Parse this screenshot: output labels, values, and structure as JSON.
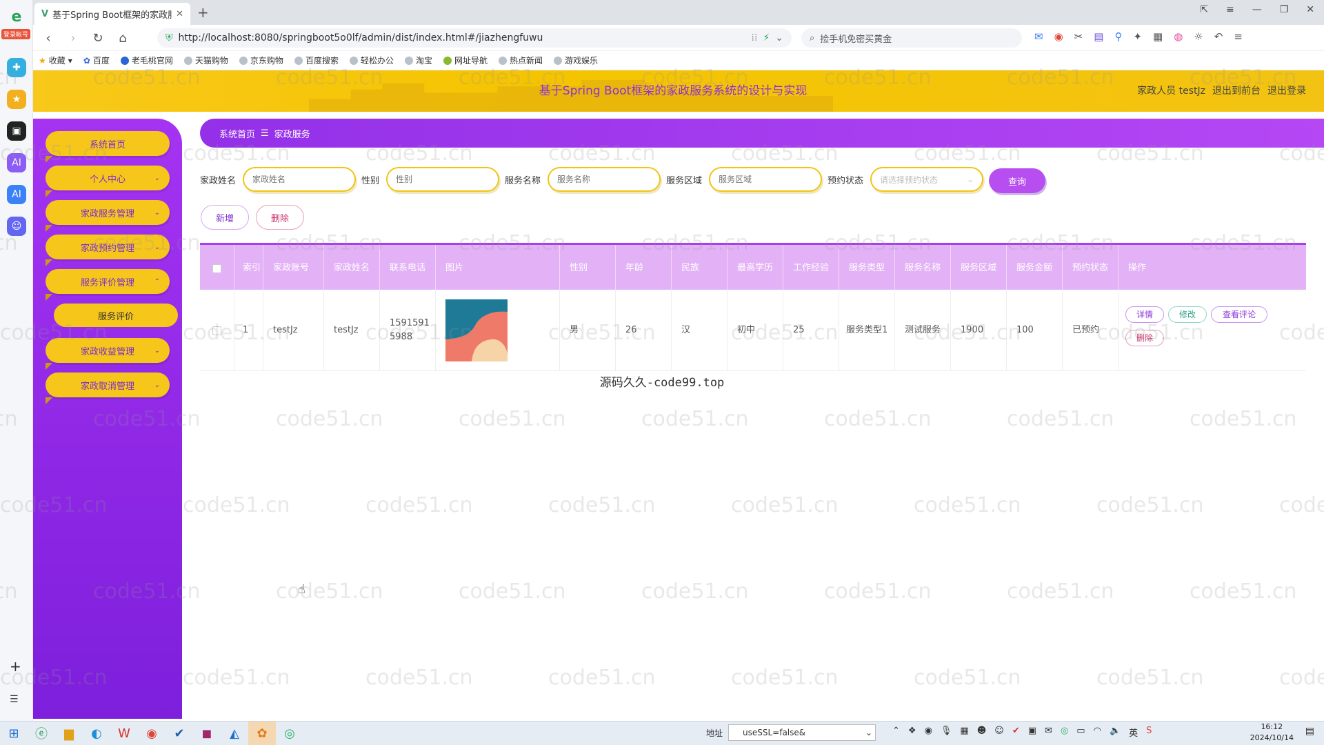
{
  "browser": {
    "tab_title": "基于Spring Boot框架的家政服",
    "url": "http://localhost:8080/springboot5o0lf/admin/dist/index.html#/jiazhengfuwu",
    "search_placeholder": "捡手机免密买黄金",
    "login_badge": "登录帐号",
    "bookmarks": [
      "收藏",
      "百度",
      "老毛桃官网",
      "天猫购物",
      "京东购物",
      "百度搜索",
      "轻松办公",
      "淘宝",
      "网址导航",
      "热点新闻",
      "游戏娱乐"
    ]
  },
  "header": {
    "title": "基于Spring Boot框架的家政服务系统的设计与实现",
    "user_role": "家政人员 testJz",
    "back_front": "退出到前台",
    "logout": "退出登录"
  },
  "sidebar": {
    "items": [
      {
        "label": "系统首页"
      },
      {
        "label": "个人中心"
      },
      {
        "label": "家政服务管理"
      },
      {
        "label": "家政预约管理"
      },
      {
        "label": "服务评价管理"
      },
      {
        "label": "服务评价"
      },
      {
        "label": "家政收益管理"
      },
      {
        "label": "家政取消管理"
      }
    ]
  },
  "breadcrumb": {
    "home": "系统首页",
    "sep": "☰",
    "current": "家政服务"
  },
  "filters": {
    "name_label": "家政姓名",
    "name_placeholder": "家政姓名",
    "gender_label": "性别",
    "gender_placeholder": "性别",
    "service_label": "服务名称",
    "service_placeholder": "服务名称",
    "area_label": "服务区域",
    "area_placeholder": "服务区域",
    "status_label": "预约状态",
    "status_placeholder": "请选择预约状态",
    "query_button": "查询"
  },
  "actions": {
    "add": "新增",
    "delete": "删除"
  },
  "table": {
    "headers": [
      "索引",
      "家政账号",
      "家政姓名",
      "联系电话",
      "图片",
      "性别",
      "年龄",
      "民族",
      "最高学历",
      "工作经验",
      "服务类型",
      "服务名称",
      "服务区域",
      "服务金额",
      "预约状态",
      "操作"
    ],
    "rows": [
      {
        "index": "1",
        "account": "testJz",
        "name": "testJz",
        "phone": "15915915988",
        "gender": "男",
        "age": "26",
        "ethnicity": "汉",
        "education": "初中",
        "experience": "25",
        "service_type": "服务类型1",
        "service_name": "测试服务",
        "area": "1900",
        "amount": "100",
        "status": "已预约",
        "ops": {
          "detail": "详情",
          "edit": "修改",
          "review": "查看评论",
          "delete": "删除"
        }
      }
    ]
  },
  "overlay_text": "源码久久-code99.top",
  "watermark": "code51.cn",
  "taskbar": {
    "addr_label": "地址",
    "addr_value": "useSSL=false&",
    "time": "16:12",
    "date": "2024/10/14",
    "ime": "英"
  },
  "colors": {
    "header": "#f5c400",
    "sidebar": "#9a2ff0",
    "table_header": "#e3b2f6",
    "title": "#8f2fd8"
  }
}
